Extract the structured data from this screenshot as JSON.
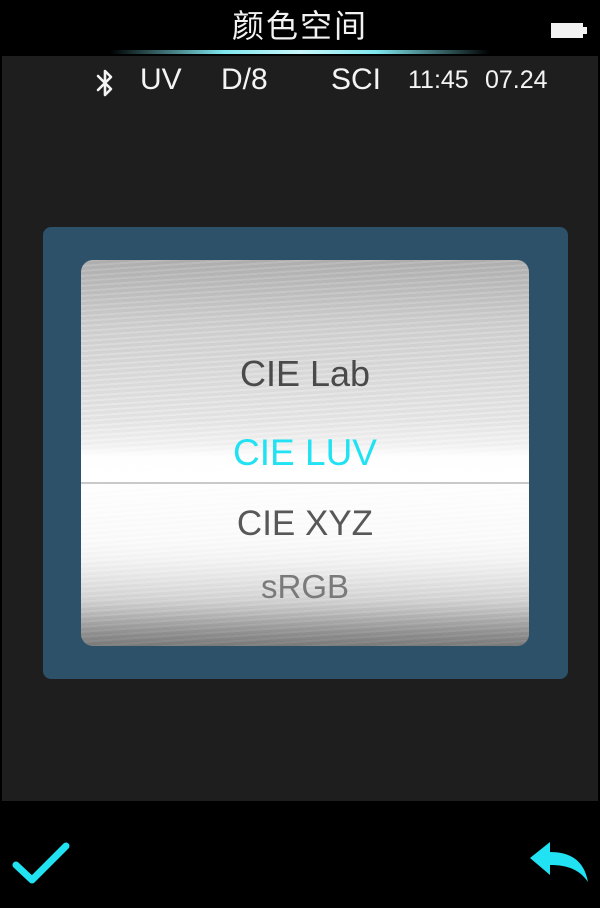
{
  "header": {
    "title": "颜色空间"
  },
  "status": {
    "uv": "UV",
    "geometry": "D/8",
    "mode": "SCI",
    "time": "11:45",
    "date": "07.24"
  },
  "icons": {
    "status": "bluetooth-icon",
    "battery": "battery-icon",
    "confirm": "checkmark-icon",
    "back": "back-arrow-icon"
  },
  "picker": {
    "options": [
      "CIE Lab",
      "CIE LUV",
      "CIE XYZ",
      "sRGB"
    ],
    "selected": "CIE LUV"
  },
  "colors": {
    "accent": "#20e2f2",
    "panel": "#2c5169",
    "screen": "#1e1e1e"
  }
}
